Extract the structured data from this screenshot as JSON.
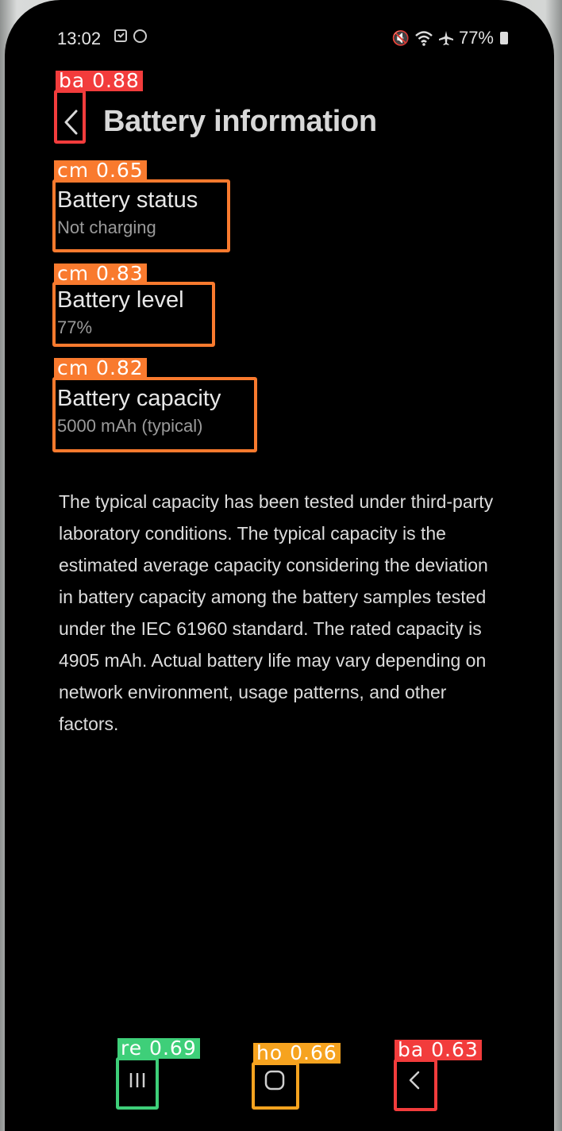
{
  "status_bar": {
    "time": "13:02",
    "battery_percent": "77%",
    "icons": [
      "checkbox-notification-icon",
      "circle-notification-icon",
      "mute-icon",
      "wifi-icon",
      "airplane-mode-icon",
      "battery-icon"
    ]
  },
  "header": {
    "title": "Battery information",
    "back_icon": "chevron-left-icon"
  },
  "items": [
    {
      "title": "Battery status",
      "subtitle": "Not charging"
    },
    {
      "title": "Battery level",
      "subtitle": "77%"
    },
    {
      "title": "Battery capacity",
      "subtitle": "5000 mAh (typical)"
    }
  ],
  "description": "The typical capacity has been tested under third-party laboratory conditions. The typical capacity is the estimated average capacity considering the deviation in battery capacity among the battery samples tested under the IEC 61960 standard. The rated capacity is 4905 mAh. Actual battery life may vary depending on network environment, usage patterns, and other factors.",
  "detections": [
    {
      "label": "ba 0.88",
      "color": "#f23c3c"
    },
    {
      "label": "cm 0.65",
      "color": "#f97a2e"
    },
    {
      "label": "cm 0.83",
      "color": "#f97a2e"
    },
    {
      "label": "cm 0.82",
      "color": "#f97a2e"
    },
    {
      "label": "re 0.69",
      "color": "#3ecf79"
    },
    {
      "label": "ho 0.66",
      "color": "#f6a31f"
    },
    {
      "label": "ba 0.63",
      "color": "#f23c3c"
    }
  ],
  "nav_bar": {
    "recents_icon": "recents-icon",
    "home_icon": "home-icon",
    "back_icon": "back-icon"
  }
}
